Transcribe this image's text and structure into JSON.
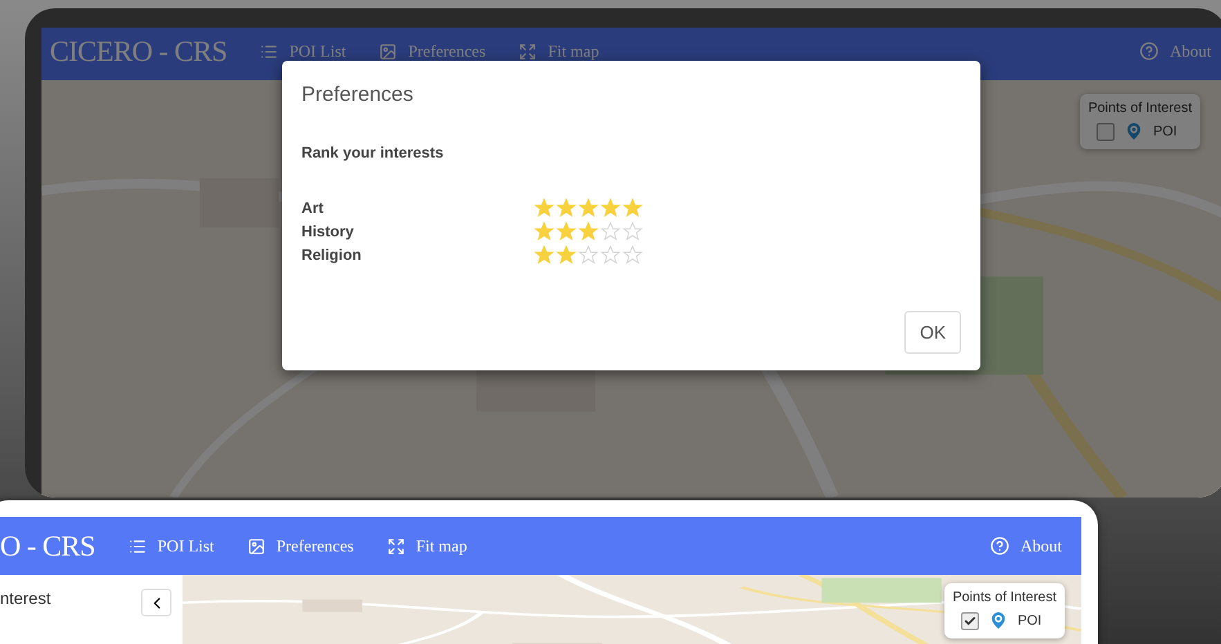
{
  "back_window": {
    "navbar": {
      "logo": "CICERO - CRS",
      "items": [
        {
          "label": "POI List"
        },
        {
          "label": "Preferences"
        },
        {
          "label": "Fit map"
        }
      ],
      "about": "About"
    },
    "layer_control": {
      "title": "Points of Interest",
      "items": [
        {
          "label": "POI",
          "checked": false
        }
      ]
    },
    "dialog": {
      "title": "Preferences",
      "subtitle": "Rank your interests",
      "interests": [
        {
          "label": "Art",
          "stars": 5
        },
        {
          "label": "History",
          "stars": 3
        },
        {
          "label": "Religion",
          "stars": 2
        }
      ],
      "ok": "OK"
    }
  },
  "front_window": {
    "navbar": {
      "logo": "O - CRS",
      "items": [
        {
          "label": "POI List"
        },
        {
          "label": "Preferences"
        },
        {
          "label": "Fit map"
        }
      ],
      "about": "About"
    },
    "sidebar": {
      "title": "nterest"
    },
    "layer_control": {
      "title": "Points of Interest",
      "items": [
        {
          "label": "POI",
          "checked": true
        }
      ]
    }
  }
}
